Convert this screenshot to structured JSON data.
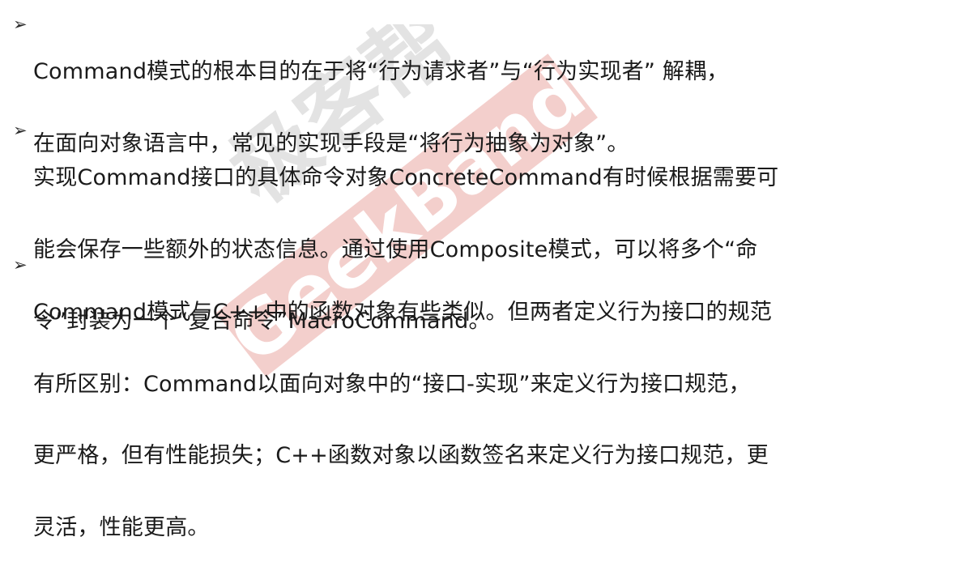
{
  "points": [
    {
      "bullet": "➢",
      "lines": [
        "Command模式的根本目的在于将“行为请求者”与“行为实现者” 解耦，",
        "在面向对象语言中，常见的实现手段是“将行为抽象为对象”。"
      ]
    },
    {
      "bullet": "➢",
      "lines": [
        "实现Command接口的具体命令对象ConcreteCommand有时候根据需要可",
        "能会保存一些额外的状态信息。通过使用Composite模式，可以将多个“命",
        "令”封装为一个“复合命令”MacroCommand。"
      ]
    },
    {
      "bullet": "➢",
      "lines": [
        "Command模式与C++中的函数对象有些类似。但两者定义行为接口的规范",
        "有所区别：Command以面向对象中的“接口-实现”来定义行为接口规范，",
        "更严格，但有性能损失；C++函数对象以函数签名来定义行为接口规范，更",
        "灵活，性能更高。"
      ]
    }
  ],
  "watermark": {
    "text_latin": "GeekBand",
    "text_cjk": "极客帮",
    "color": "#e8a09a",
    "color_cjk": "#c9c9c9"
  }
}
